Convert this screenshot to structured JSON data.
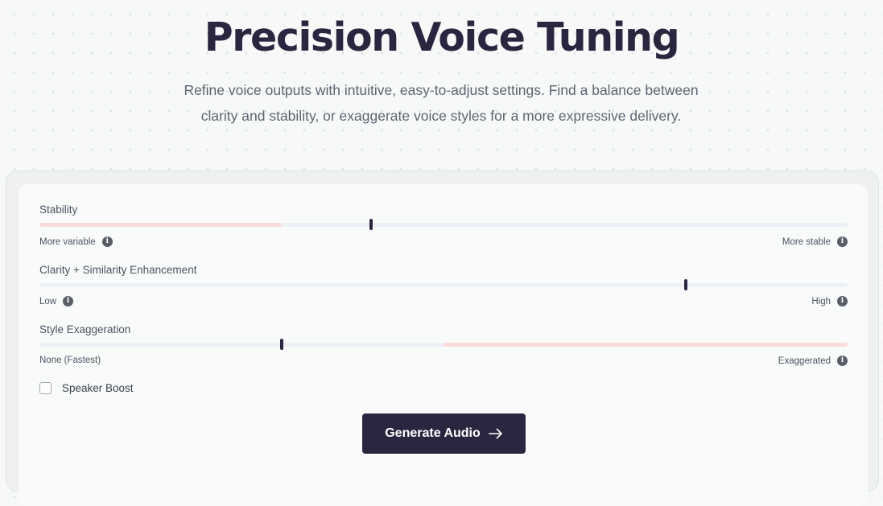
{
  "hero": {
    "title": "Precision Voice Tuning",
    "subtitle_line1": "Refine voice outputs with intuitive, easy-to-adjust settings. Find a balance between",
    "subtitle_line2": "clarity and stability, or exaggerate voice styles for a more expressive delivery."
  },
  "colors": {
    "primary": "#2b2640",
    "fill": "#fcdcd8",
    "track": "#edf0f5"
  },
  "sliders": [
    {
      "label": "Stability",
      "value": 0.41,
      "fill_from": 0,
      "fill_to": 0.3,
      "min_label": "More variable",
      "min_icon": "info-icon",
      "max_label": "More stable",
      "max_icon": "info-icon"
    },
    {
      "label": "Clarity + Similarity Enhancement",
      "value": 0.8,
      "fill_from": 0,
      "fill_to": 0,
      "min_label": "Low",
      "min_icon": "info-icon",
      "max_label": "High",
      "max_icon": "info-icon"
    },
    {
      "label": "Style Exaggeration",
      "value": 0.3,
      "fill_from": 0.5,
      "fill_to": 1,
      "min_label": "None (Fastest)",
      "min_icon": "",
      "max_label": "Exaggerated",
      "max_icon": "info-icon"
    }
  ],
  "speaker_boost": {
    "label": "Speaker Boost",
    "checked": false
  },
  "generate_button": {
    "label": "Generate Audio",
    "icon": "arrow-right-icon"
  }
}
